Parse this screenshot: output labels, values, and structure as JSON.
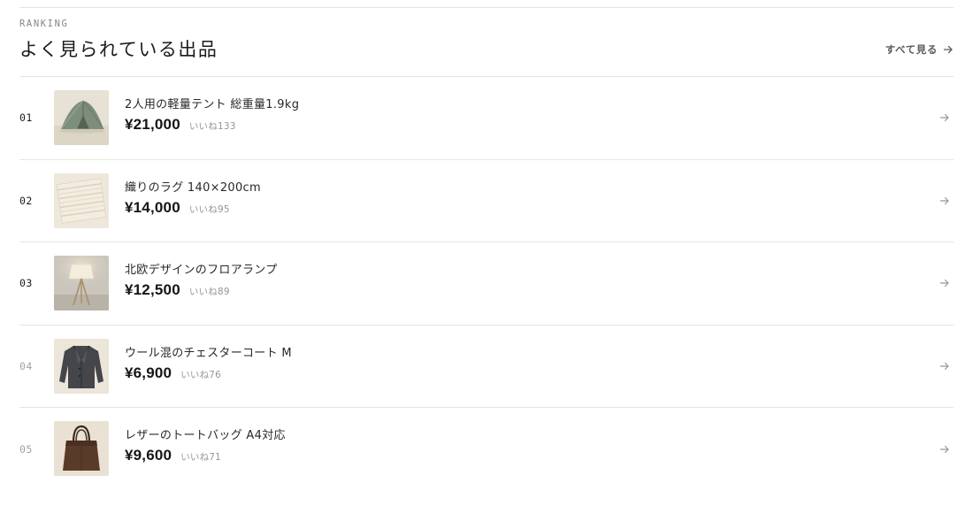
{
  "section": {
    "eyebrow": "RANKING",
    "title": "よく見られている出品",
    "see_all_label": "すべて見る"
  },
  "items": [
    {
      "rank": "01",
      "name": "2人用の軽量テント 総重量1.9kg",
      "price": "¥21,000",
      "likes": "いいね133",
      "thumb_icon": "tent-icon",
      "rank_muted": false
    },
    {
      "rank": "02",
      "name": "織りのラグ 140×200cm",
      "price": "¥14,000",
      "likes": "いいね95",
      "thumb_icon": "rug-icon",
      "rank_muted": false
    },
    {
      "rank": "03",
      "name": "北欧デザインのフロアランプ",
      "price": "¥12,500",
      "likes": "いいね89",
      "thumb_icon": "floor-lamp-icon",
      "rank_muted": false
    },
    {
      "rank": "04",
      "name": "ウール混のチェスターコート M",
      "price": "¥6,900",
      "likes": "いいね76",
      "thumb_icon": "coat-icon",
      "rank_muted": true
    },
    {
      "rank": "05",
      "name": "レザーのトートバッグ A4対応",
      "price": "¥9,600",
      "likes": "いいね71",
      "thumb_icon": "tote-bag-icon",
      "rank_muted": true
    }
  ],
  "colors": {
    "text": "#1b1b1b",
    "muted_rank": "#a6a29b",
    "divider": "#e6e2da",
    "likes": "#9a968f"
  }
}
